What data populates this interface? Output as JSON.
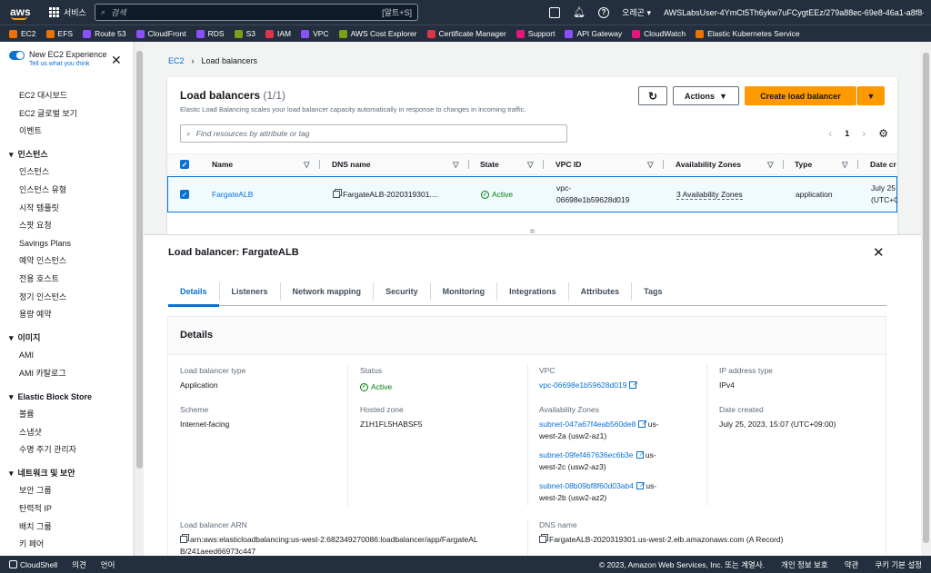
{
  "topbar": {
    "services": "서비스",
    "search_placeholder": "검색",
    "search_shortcut": "[알트+S]",
    "region": "오레곤",
    "account": "AWSLabsUser-4YmCt5Th6ykw7uFCygtEEz/279a88ec-69e8-46a1-a8f8-fc..."
  },
  "favorites": [
    {
      "label": "EC2",
      "color": "#ed7100"
    },
    {
      "label": "EFS",
      "color": "#ed7100"
    },
    {
      "label": "Route 53",
      "color": "#8c4fff"
    },
    {
      "label": "CloudFront",
      "color": "#8c4fff"
    },
    {
      "label": "RDS",
      "color": "#8c4fff"
    },
    {
      "label": "S3",
      "color": "#7aa116"
    },
    {
      "label": "IAM",
      "color": "#dd344c"
    },
    {
      "label": "VPC",
      "color": "#8c4fff"
    },
    {
      "label": "AWS Cost Explorer",
      "color": "#7aa116"
    },
    {
      "label": "Certificate Manager",
      "color": "#dd344c"
    },
    {
      "label": "Support",
      "color": "#e7157b"
    },
    {
      "label": "API Gateway",
      "color": "#8c4fff"
    },
    {
      "label": "CloudWatch",
      "color": "#e7157b"
    },
    {
      "label": "Elastic Kubernetes Service",
      "color": "#ed7100"
    }
  ],
  "sidebar": {
    "new_exp": "New EC2 Experience",
    "new_exp_link": "Tell us what you think",
    "top": [
      "EC2 대시보드",
      "EC2 글로벌 보기",
      "이벤트"
    ],
    "sec1": "인스턴스",
    "sec1_items": [
      "인스턴스",
      "인스턴스 유형",
      "시작 템플릿",
      "스팟 요청",
      "Savings Plans",
      "예약 인스턴스",
      "전용 호스트",
      "정기 인스턴스",
      "용량 예약"
    ],
    "sec2": "이미지",
    "sec2_items": [
      "AMI",
      "AMI 카탈로그"
    ],
    "sec3": "Elastic Block Store",
    "sec3_items": [
      "볼륨",
      "스냅샷",
      "수명 주기 관리자"
    ],
    "sec4": "네트워크 및 보안",
    "sec4_items": [
      "보안 그룹",
      "탄력적 IP",
      "배치 그룹",
      "키 페어"
    ]
  },
  "breadcrumb": {
    "root": "EC2",
    "current": "Load balancers"
  },
  "list": {
    "title": "Load balancers",
    "count": "(1/1)",
    "subtitle": "Elastic Load Balancing scales your load balancer capacity automatically in response to changes in incoming traffic.",
    "actions": "Actions",
    "create": "Create load balancer",
    "filter_placeholder": "Find resources by attribute or tag",
    "page": "1",
    "columns": [
      "Name",
      "DNS name",
      "State",
      "VPC ID",
      "Availability Zones",
      "Type",
      "Date cr"
    ],
    "row": {
      "name": "FargateALB",
      "dns": "FargateALB-2020319301....",
      "state": "Active",
      "vpc_line1": "vpc-",
      "vpc_line2": "06698e1b59628d019",
      "az": "3 Availability Zones",
      "type": "application",
      "date_line1": "July 25",
      "date_line2": "(UTC+0"
    }
  },
  "detail": {
    "title": "Load balancer: FargateALB",
    "tabs": [
      "Details",
      "Listeners",
      "Network mapping",
      "Security",
      "Monitoring",
      "Integrations",
      "Attributes",
      "Tags"
    ],
    "section": "Details",
    "lb_type_label": "Load balancer type",
    "lb_type": "Application",
    "scheme_label": "Scheme",
    "scheme": "Internet-facing",
    "status_label": "Status",
    "status": "Active",
    "zone_label": "Hosted zone",
    "zone": "Z1H1FL5HABSF5",
    "vpc_label": "VPC",
    "vpc": "vpc-06698e1b59628d019",
    "az_label": "Availability Zones",
    "subnet1": "subnet-047a67f4eab560de8",
    "subnet1_zone_a": "us-",
    "subnet1_zone_b": "west-2a (usw2-az1)",
    "subnet2": "subnet-09fef467636ec6b3e",
    "subnet2_zone_a": "us-",
    "subnet2_zone_b": "west-2c (usw2-az3)",
    "subnet3": "subnet-08b09bf8f60d03ab4",
    "subnet3_zone_a": "us-",
    "subnet3_zone_b": "west-2b (usw2-az2)",
    "ip_label": "IP address type",
    "ip": "IPv4",
    "date_label": "Date created",
    "date": "July 25, 2023, 15:07 (UTC+09:00)",
    "arn_label": "Load balancer ARN",
    "arn_line1": "arn:aws:elasticloadbalancing:us-west-2:682349270086:loadbalancer/app/FargateAL",
    "arn_line2": "B/241aeed66973c447",
    "dns_label": "DNS name",
    "dns": "FargateALB-2020319301.us-west-2.elb.amazonaws.com (A Record)"
  },
  "footer": {
    "cloudshell": "CloudShell",
    "feedback": "의견",
    "language": "언어",
    "copyright": "© 2023, Amazon Web Services, Inc. 또는 계열사.",
    "privacy": "개인 정보 보호",
    "terms": "약관",
    "cookies": "쿠키 기본 설정"
  }
}
